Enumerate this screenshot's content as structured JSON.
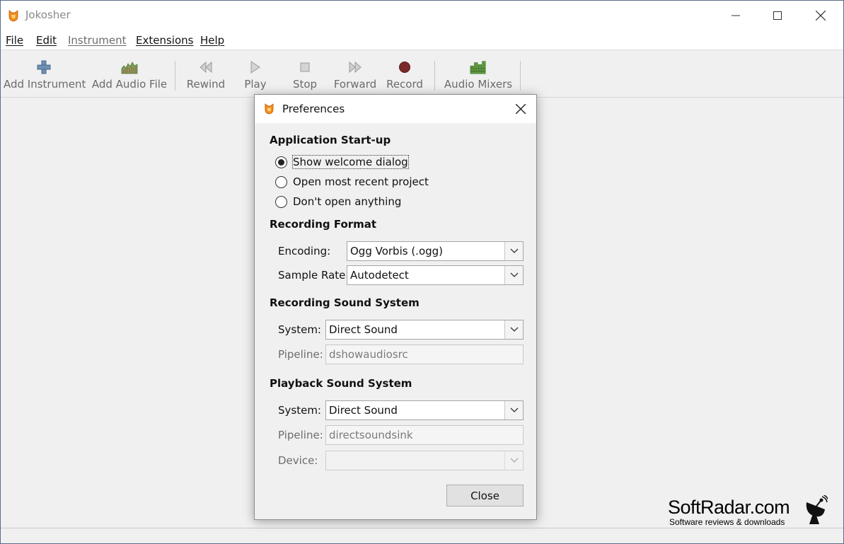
{
  "window": {
    "title": "Jokosher"
  },
  "menu": [
    {
      "label": "File",
      "dim": false
    },
    {
      "label": "Edit",
      "dim": false
    },
    {
      "label": "Instrument",
      "dim": true
    },
    {
      "label": "Extensions",
      "dim": false
    },
    {
      "label": "Help",
      "dim": false
    }
  ],
  "toolbar": {
    "add_instrument": "Add Instrument",
    "add_audio_file": "Add Audio File",
    "rewind": "Rewind",
    "play": "Play",
    "stop": "Stop",
    "forward": "Forward",
    "record": "Record",
    "audio_mixers": "Audio Mixers"
  },
  "dialog": {
    "title": "Preferences",
    "startup": {
      "heading": "Application Start-up",
      "options": [
        {
          "label": "Show welcome dialog",
          "checked": true
        },
        {
          "label": "Open most recent project",
          "checked": false
        },
        {
          "label": "Don't open anything",
          "checked": false
        }
      ]
    },
    "recording_format": {
      "heading": "Recording Format",
      "encoding_label": "Encoding:",
      "encoding_value": "Ogg Vorbis (.ogg)",
      "sample_rate_label": "Sample Rate:",
      "sample_rate_value": "Autodetect"
    },
    "recording_sound": {
      "heading": "Recording Sound System",
      "system_label": "System:",
      "system_value": "Direct Sound",
      "pipeline_label": "Pipeline:",
      "pipeline_value": "dshowaudiosrc"
    },
    "playback_sound": {
      "heading": "Playback Sound System",
      "system_label": "System:",
      "system_value": "Direct Sound",
      "pipeline_label": "Pipeline:",
      "pipeline_value": "directsoundsink",
      "device_label": "Device:",
      "device_value": ""
    },
    "close_button": "Close"
  },
  "watermark": {
    "title": "SoftRadar.com",
    "subtitle": "Software reviews & downloads"
  },
  "colors": {
    "app_icon": "#f28c1a",
    "record_dot": "#7a2a2a",
    "mixer_green": "#5a9a3a"
  }
}
